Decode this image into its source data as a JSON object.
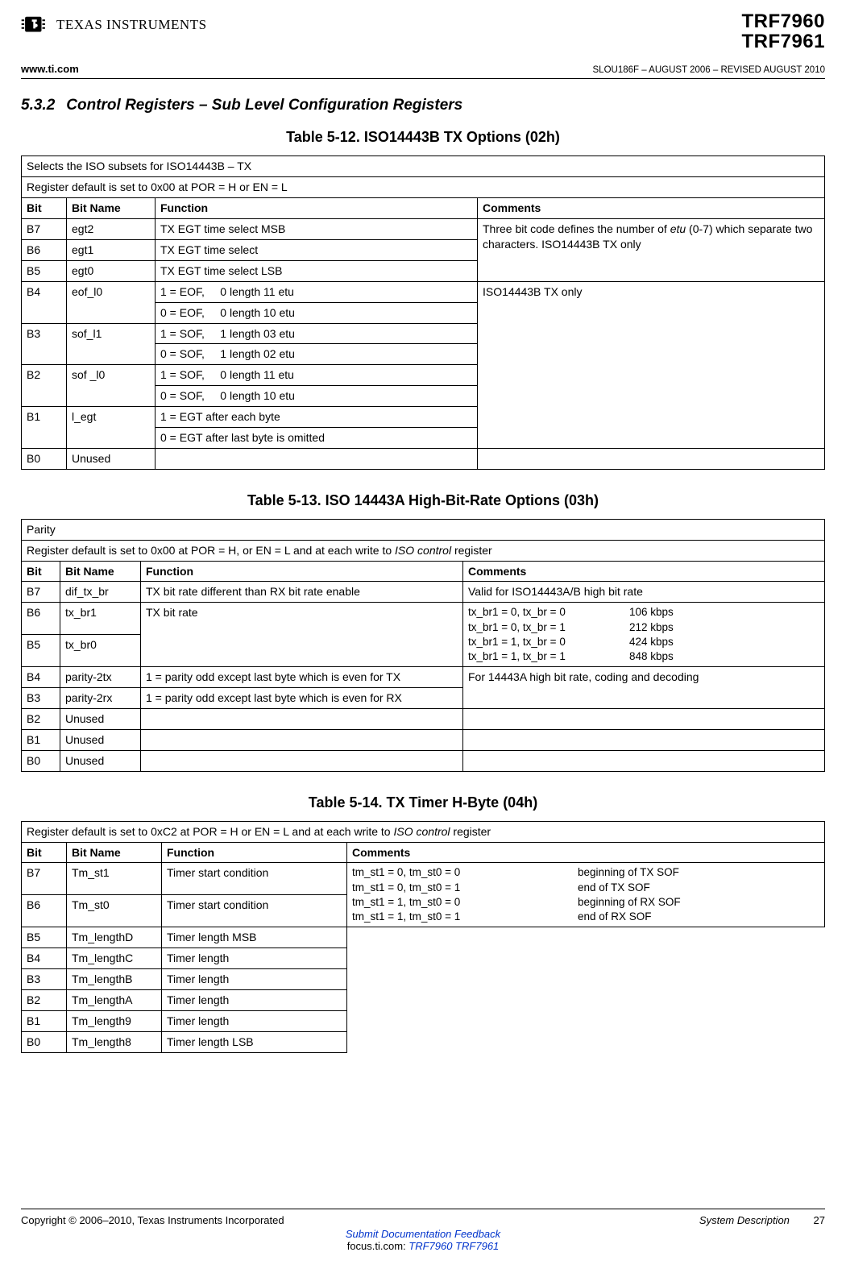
{
  "header": {
    "logo_text": "TEXAS INSTRUMENTS",
    "parts": [
      "TRF7960",
      "TRF7961"
    ],
    "www": "www.ti.com",
    "docid": "SLOU186F – AUGUST 2006 – REVISED AUGUST 2010"
  },
  "section": {
    "number": "5.3.2",
    "title": "Control Registers – Sub Level Configuration Registers"
  },
  "table12": {
    "caption": "Table 5-12. ISO14443B TX Options (02h)",
    "desc1": "Selects the ISO subsets for ISO14443B – TX",
    "desc2": "Register default is set to 0x00 at POR = H or EN = L",
    "h_bit": "Bit",
    "h_name": "Bit Name",
    "h_func": "Function",
    "h_comm": "Comments",
    "rows": {
      "b7": {
        "bit": "B7",
        "name": "egt2",
        "func": "TX EGT time select MSB"
      },
      "b6": {
        "bit": "B6",
        "name": "egt1",
        "func": "TX EGT time select"
      },
      "b5": {
        "bit": "B5",
        "name": "egt0",
        "func": "TX EGT time select LSB"
      },
      "b4": {
        "bit": "B4",
        "name": "eof_l0",
        "f1": "1 = EOF,     0 length 11 etu",
        "f0": "0 = EOF,     0 length 10 etu"
      },
      "b3": {
        "bit": "B3",
        "name": "sof_l1",
        "f1": "1 = SOF,     1 length 03 etu",
        "f0": "0 = SOF,     1 length 02 etu"
      },
      "b2": {
        "bit": "B2",
        "name": "sof _l0",
        "f1": "1 = SOF,     0 length 11 etu",
        "f0": "0 = SOF,     0 length 10 etu"
      },
      "b1": {
        "bit": "B1",
        "name": "l_egt",
        "f1": "1 = EGT after each byte",
        "f0": "0 = EGT after last byte is omitted"
      },
      "b0": {
        "bit": "B0",
        "name": "Unused"
      }
    },
    "comm_egt_a": "Three bit code defines the number of ",
    "comm_egt_b": "etu",
    "comm_egt_c": " (0-7) which separate two characters. ISO14443B TX only",
    "comm_iso": "ISO14443B TX only"
  },
  "table13": {
    "caption": "Table 5-13. ISO 14443A High-Bit-Rate Options (03h)",
    "desc1": "Parity",
    "desc2a": "Register default is set to 0x00 at POR = H, or EN = L and at each write to ",
    "desc2b": "ISO control",
    "desc2c": " register",
    "h_bit": "Bit",
    "h_name": "Bit Name",
    "h_func": "Function",
    "h_comm": "Comments",
    "rows": {
      "b7": {
        "bit": "B7",
        "name": "dif_tx_br",
        "func": "TX bit rate different than RX bit rate enable",
        "comm": "Valid for ISO14443A/B high bit rate"
      },
      "b6": {
        "bit": "B6",
        "name": "tx_br1",
        "func": "TX bit rate"
      },
      "b5": {
        "bit": "B5",
        "name": "tx_br0"
      },
      "b4": {
        "bit": "B4",
        "name": "parity-2tx",
        "func": "1 = parity odd except last byte which is even for TX"
      },
      "b3": {
        "bit": "B3",
        "name": "parity-2rx",
        "func": "1 = parity odd except last byte which is even for RX"
      },
      "b2": {
        "bit": "B2",
        "name": "Unused"
      },
      "b1": {
        "bit": "B1",
        "name": "Unused"
      },
      "b0": {
        "bit": "B0",
        "name": "Unused"
      }
    },
    "br_comment": {
      "l1a": "tx_br1 = 0, tx_br = 0",
      "l1b": "106 kbps",
      "l2a": "tx_br1 = 0, tx_br = 1",
      "l2b": "212 kbps",
      "l3a": "tx_br1 = 1, tx_br = 0",
      "l3b": "424 kbps",
      "l4a": "tx_br1 = 1, tx_br = 1",
      "l4b": "848 kbps"
    },
    "parity_comm": "For 14443A high bit rate, coding and decoding"
  },
  "table14": {
    "caption": "Table 5-14. TX Timer H-Byte (04h)",
    "desc_a": "Register default is set to 0xC2 at POR = H or EN = L and at each write to ",
    "desc_b": "ISO control",
    "desc_c": " register",
    "h_bit": "Bit",
    "h_name": "Bit Name",
    "h_func": "Function",
    "h_comm": "Comments",
    "rows": {
      "b7": {
        "bit": "B7",
        "name": "Tm_st1",
        "func": "Timer start condition"
      },
      "b6": {
        "bit": "B6",
        "name": "Tm_st0",
        "func": "Timer start condition"
      },
      "b5": {
        "bit": "B5",
        "name": "Tm_lengthD",
        "func": "Timer length MSB"
      },
      "b4": {
        "bit": "B4",
        "name": "Tm_lengthC",
        "func": "Timer length"
      },
      "b3": {
        "bit": "B3",
        "name": "Tm_lengthB",
        "func": "Timer length"
      },
      "b2": {
        "bit": "B2",
        "name": "Tm_lengthA",
        "func": "Timer length"
      },
      "b1": {
        "bit": "B1",
        "name": "Tm_length9",
        "func": "Timer length"
      },
      "b0": {
        "bit": "B0",
        "name": "Tm_length8",
        "func": "Timer length LSB"
      }
    },
    "st_comment": {
      "l1a": "tm_st1 = 0, tm_st0 = 0",
      "l1b": "beginning of TX SOF",
      "l2a": "tm_st1 = 0, tm_st0 = 1",
      "l2b": "end of TX SOF",
      "l3a": "tm_st1 = 1, tm_st0 = 0",
      "l3b": "beginning of RX SOF",
      "l4a": "tm_st1 = 1, tm_st0 = 1",
      "l4b": "end of RX SOF"
    }
  },
  "footer": {
    "copyright": "Copyright © 2006–2010, Texas Instruments Incorporated",
    "section": "System Description",
    "page": "27",
    "feedback": "Submit Documentation Feedback",
    "focus_pre": "focus.ti.com: ",
    "focus_link": "TRF7960 TRF7961"
  }
}
